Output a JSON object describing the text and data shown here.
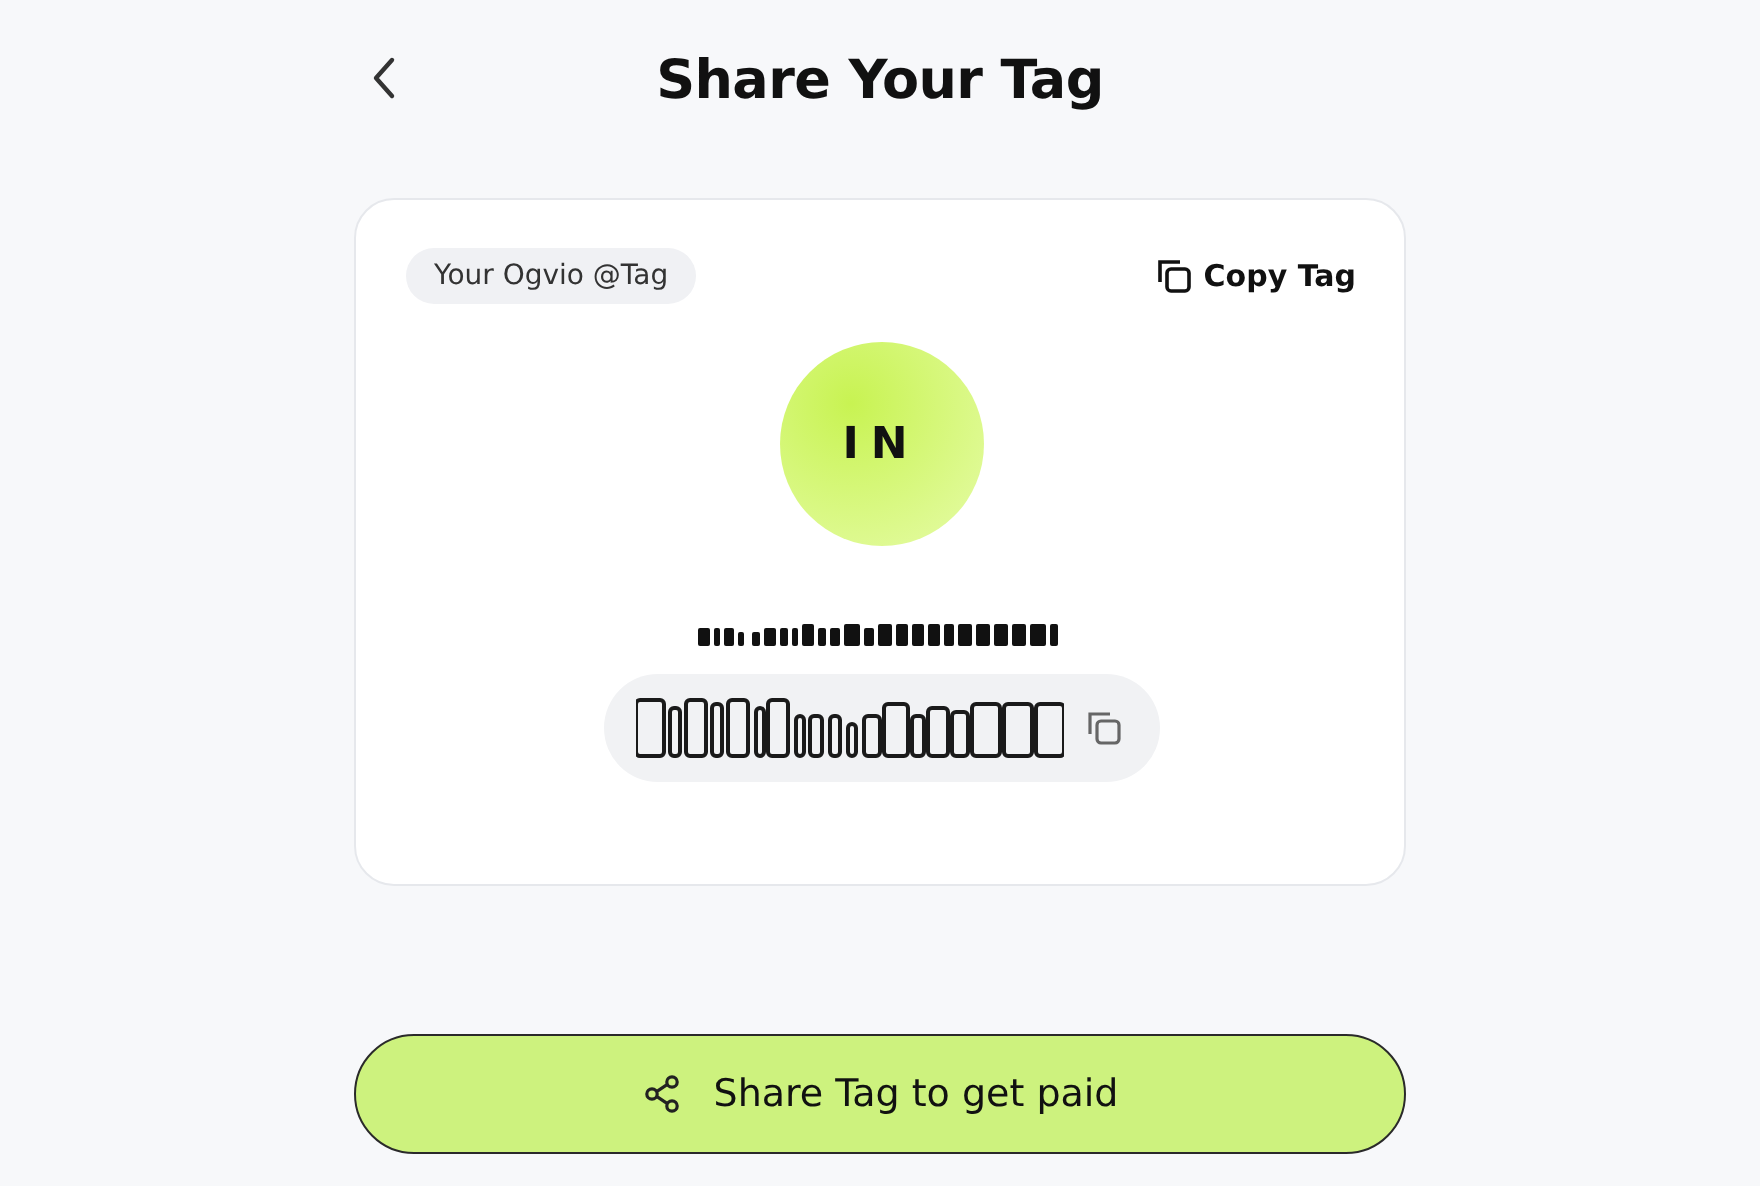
{
  "header": {
    "title": "Share Your Tag"
  },
  "card": {
    "label": "Your Ogvio @Tag",
    "copy_action": "Copy Tag",
    "avatar_initials": "IN"
  },
  "share_button": {
    "label": "Share Tag to get paid"
  }
}
